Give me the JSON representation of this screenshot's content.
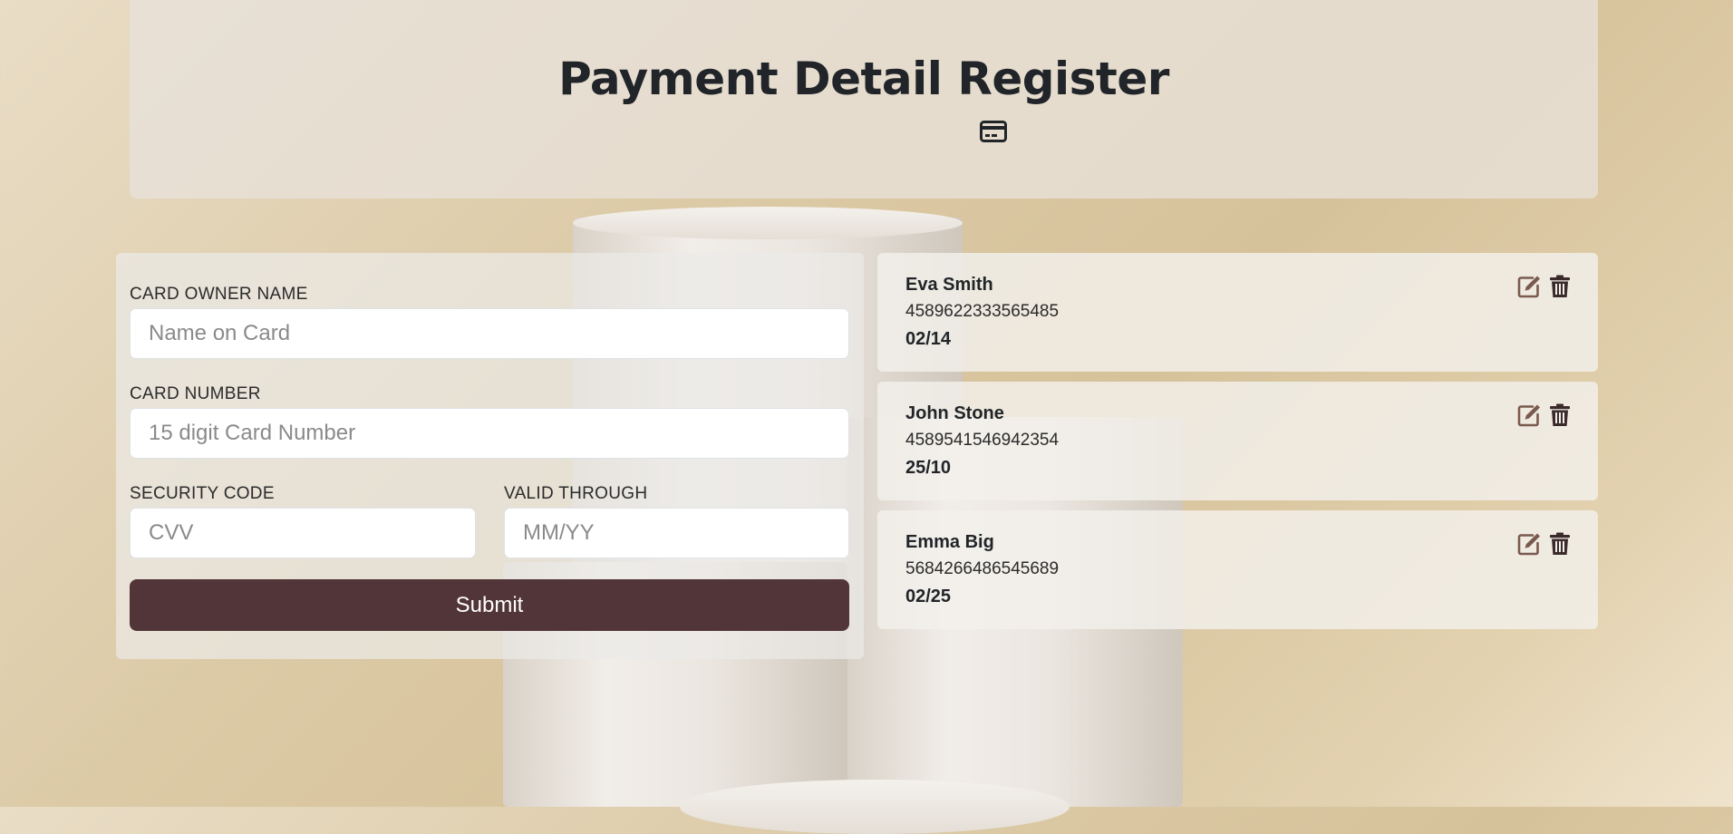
{
  "header": {
    "title": "Payment Detail Register",
    "icon": "credit-card-icon"
  },
  "form": {
    "owner_label": "CARD OWNER NAME",
    "owner_placeholder": "Name on Card",
    "owner_value": "",
    "number_label": "CARD NUMBER",
    "number_placeholder": "15 digit Card Number",
    "number_value": "",
    "cvv_label": "SECURITY CODE",
    "cvv_placeholder": "CVV",
    "cvv_value": "",
    "exp_label": "VALID THROUGH",
    "exp_placeholder": "MM/YY",
    "exp_value": "",
    "submit_label": "Submit"
  },
  "cards": [
    {
      "name": "Eva Smith",
      "number": "4589622333565485",
      "exp": "02/14"
    },
    {
      "name": "John Stone",
      "number": "4589541546942354",
      "exp": "25/10"
    },
    {
      "name": "Emma Big",
      "number": "5684266486545689",
      "exp": "02/25"
    }
  ],
  "colors": {
    "submit_bg": "#523538",
    "edit_icon": "#7a5a4f",
    "trash_icon": "#3b2a2a"
  }
}
